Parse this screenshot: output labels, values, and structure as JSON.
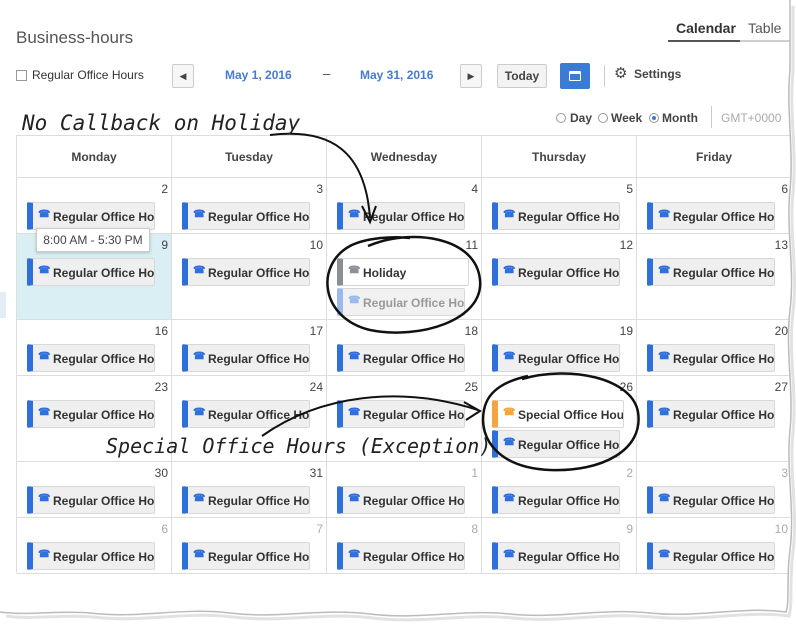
{
  "header": {
    "title": "Business-hours",
    "view_tabs": [
      "Calendar",
      "Table"
    ]
  },
  "toolbar": {
    "filter_label": "Regular Office Hours",
    "start_date": "May 1, 2016",
    "end_date": "May 31, 2016",
    "separator": "–",
    "prev_icon": "◀",
    "next_icon": "▶",
    "today_label": "Today",
    "settings_label": "Settings"
  },
  "view_options": {
    "day": "Day",
    "week": "Week",
    "month": "Month",
    "selected": "Month",
    "timezone": "GMT+0000"
  },
  "calendar": {
    "weekdays": [
      "Monday",
      "Tuesday",
      "Wednesday",
      "Thursday",
      "Friday"
    ],
    "weeks": [
      [
        {
          "day": "2",
          "events": [
            {
              "type": "regular",
              "label": "Regular Office Hou"
            }
          ]
        },
        {
          "day": "3",
          "events": [
            {
              "type": "regular",
              "label": "Regular Office Hou"
            }
          ]
        },
        {
          "day": "4",
          "events": [
            {
              "type": "regular",
              "label": "Regular Office Hou"
            }
          ]
        },
        {
          "day": "5",
          "events": [
            {
              "type": "regular",
              "label": "Regular Office Hou"
            }
          ]
        },
        {
          "day": "6",
          "events": [
            {
              "type": "regular",
              "label": "Regular Office Hou"
            }
          ]
        }
      ],
      [
        {
          "day": "9",
          "highlight": true,
          "events": [
            {
              "type": "regular",
              "label": "Regular Office Hou"
            }
          ]
        },
        {
          "day": "10",
          "events": [
            {
              "type": "regular",
              "label": "Regular Office Hou"
            }
          ]
        },
        {
          "day": "11",
          "events": [
            {
              "type": "holiday",
              "label": "Holiday"
            },
            {
              "type": "dim",
              "label": "Regular Office Hou"
            }
          ]
        },
        {
          "day": "12",
          "events": [
            {
              "type": "regular",
              "label": "Regular Office Hou"
            }
          ]
        },
        {
          "day": "13",
          "events": [
            {
              "type": "regular",
              "label": "Regular Office Hou"
            }
          ]
        }
      ],
      [
        {
          "day": "16",
          "events": [
            {
              "type": "regular",
              "label": "Regular Office Hou"
            }
          ]
        },
        {
          "day": "17",
          "events": [
            {
              "type": "regular",
              "label": "Regular Office Hou"
            }
          ]
        },
        {
          "day": "18",
          "events": [
            {
              "type": "regular",
              "label": "Regular Office Hou"
            }
          ]
        },
        {
          "day": "19",
          "events": [
            {
              "type": "regular",
              "label": "Regular Office Hou"
            }
          ]
        },
        {
          "day": "20",
          "events": [
            {
              "type": "regular",
              "label": "Regular Office Hou"
            }
          ]
        }
      ],
      [
        {
          "day": "23",
          "events": [
            {
              "type": "regular",
              "label": "Regular Office Hou"
            }
          ]
        },
        {
          "day": "24",
          "events": [
            {
              "type": "regular",
              "label": "Regular Office Hou"
            }
          ]
        },
        {
          "day": "25",
          "events": [
            {
              "type": "regular",
              "label": "Regular Office Hou"
            }
          ]
        },
        {
          "day": "26",
          "events": [
            {
              "type": "special",
              "label": "Special Office Hou"
            },
            {
              "type": "regular",
              "label": "Regular Office Hou"
            }
          ]
        },
        {
          "day": "27",
          "events": [
            {
              "type": "regular",
              "label": "Regular Office Hou"
            }
          ]
        }
      ],
      [
        {
          "day": "30",
          "events": [
            {
              "type": "regular",
              "label": "Regular Office Hou"
            }
          ]
        },
        {
          "day": "31",
          "events": [
            {
              "type": "regular",
              "label": "Regular Office Hou"
            }
          ]
        },
        {
          "day": "1",
          "other": true,
          "events": [
            {
              "type": "regular",
              "label": "Regular Office Hou"
            }
          ]
        },
        {
          "day": "2",
          "other": true,
          "events": [
            {
              "type": "regular",
              "label": "Regular Office Hou"
            }
          ]
        },
        {
          "day": "3",
          "other": true,
          "events": [
            {
              "type": "regular",
              "label": "Regular Office Hou"
            }
          ]
        }
      ],
      [
        {
          "day": "6",
          "other": true,
          "events": [
            {
              "type": "regular",
              "label": "Regular Office Hou"
            }
          ]
        },
        {
          "day": "7",
          "other": true,
          "events": [
            {
              "type": "regular",
              "label": "Regular Office Hou"
            }
          ]
        },
        {
          "day": "8",
          "other": true,
          "events": [
            {
              "type": "regular",
              "label": "Regular Office Hou"
            }
          ]
        },
        {
          "day": "9",
          "other": true,
          "events": [
            {
              "type": "regular",
              "label": "Regular Office Hou"
            }
          ]
        },
        {
          "day": "10",
          "other": true,
          "events": [
            {
              "type": "regular",
              "label": "Regular Office Hou"
            }
          ]
        }
      ]
    ]
  },
  "tooltip": {
    "text": "8:00 AM - 5:30 PM"
  },
  "annotations": {
    "holiday": "No Callback on Holiday",
    "special": "Special Office Hours (Exception)"
  },
  "colors": {
    "accent": "#3a7bd5",
    "regular_bar": "#2f6fd9",
    "holiday_bar": "#8a8f96",
    "special_bar": "#f4a540",
    "highlight_cell": "#d9eff4"
  },
  "icons": {
    "phone": "phone-icon",
    "settings": "gear-icon",
    "calendar_view": "calendar-icon"
  }
}
